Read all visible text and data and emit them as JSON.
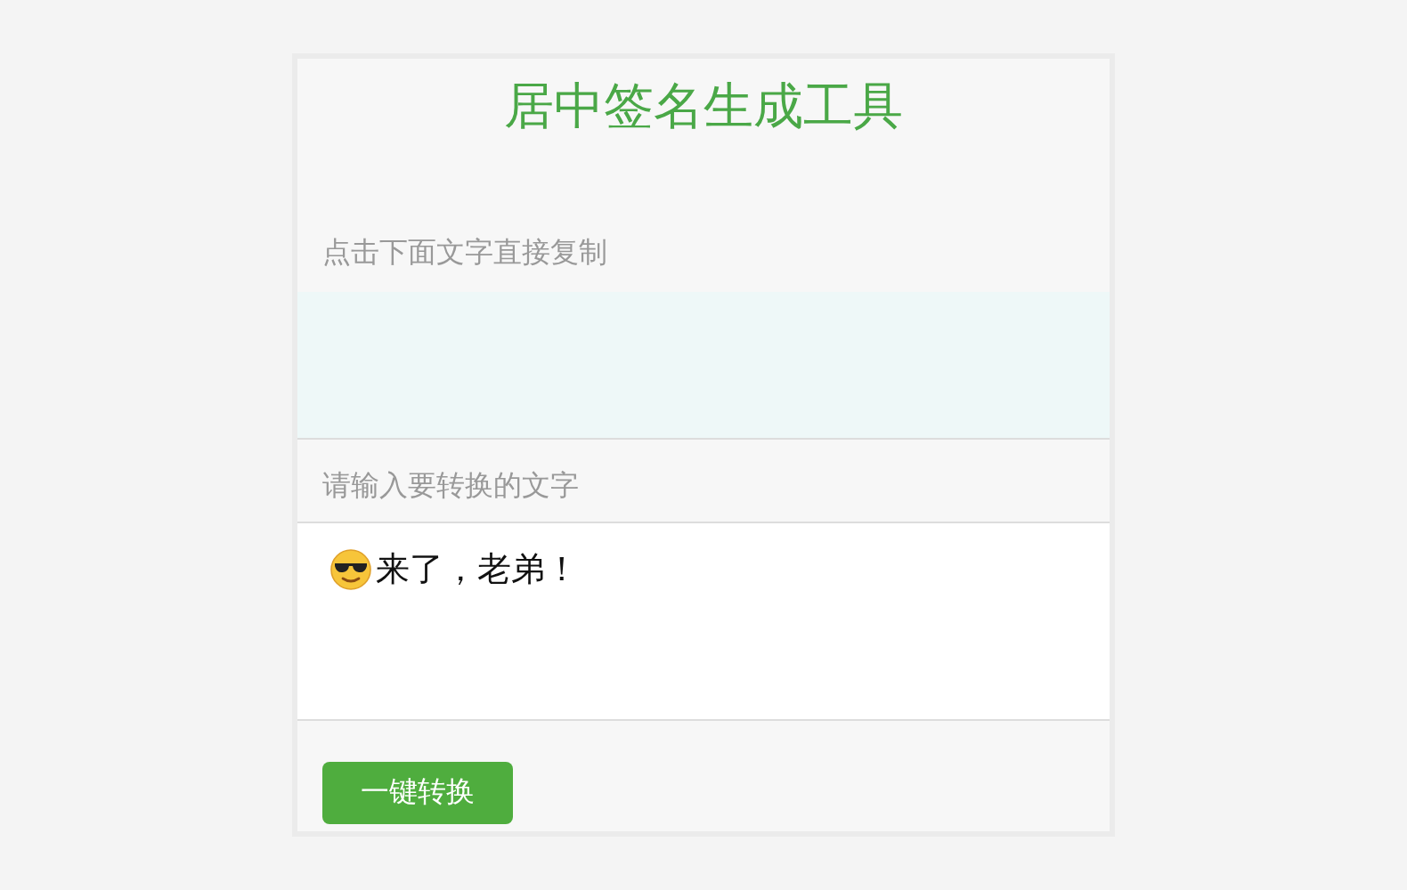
{
  "title": "居中签名生成工具",
  "output": {
    "label": "点击下面文字直接复制"
  },
  "input": {
    "label": "请输入要转换的文字",
    "value": "来了，老弟！"
  },
  "buttons": [
    {
      "label": "一键转换"
    }
  ]
}
